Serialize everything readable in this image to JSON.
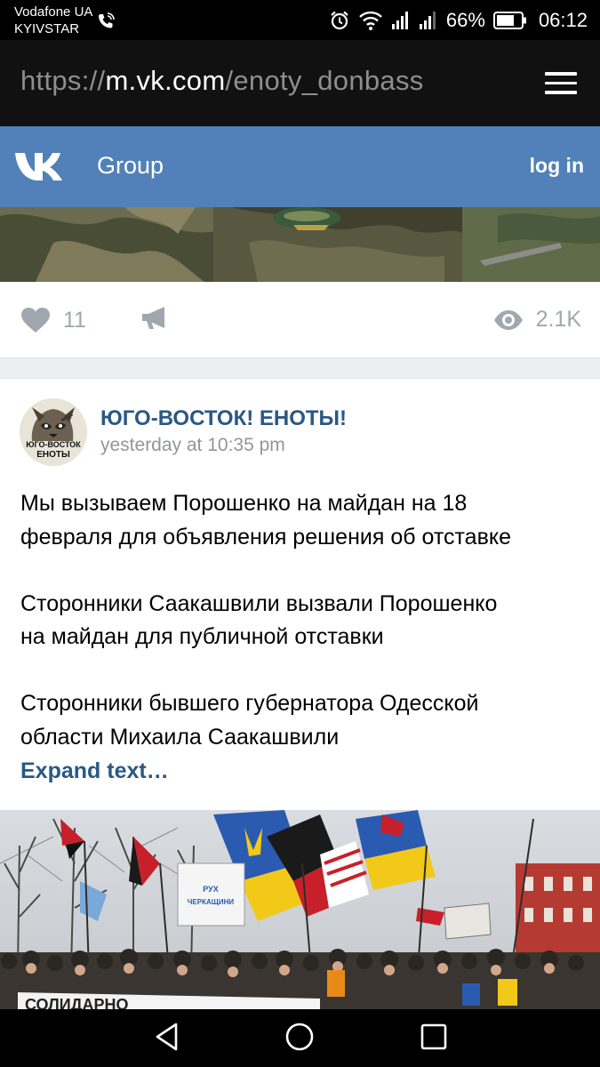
{
  "status_bar": {
    "carrier_line1": "Vodafone UA",
    "carrier_line2": "KYIVSTAR",
    "battery": "66%",
    "time": "06:12",
    "icons": [
      "wifi-call-icon",
      "alarm-icon",
      "wifi-icon",
      "signal-icon",
      "signal-icon",
      "battery-icon"
    ]
  },
  "browser": {
    "url_scheme": "https://",
    "url_host": "m.vk.com",
    "url_path": "/enoty_donbass",
    "menu_icon": "hamburger-menu-icon"
  },
  "vk_header": {
    "logo": "vk-logo",
    "title": "Group",
    "login": "log in",
    "color": "#5181b8"
  },
  "previous_post": {
    "likes": "11",
    "views": "2.1K",
    "icons": [
      "heart-icon",
      "megaphone-icon",
      "eye-icon"
    ]
  },
  "post": {
    "author": "ЮГО-ВОСТОК! ЕНОТЫ!",
    "avatar_text_line1": "ЮГО-ВОСТОК",
    "avatar_text_line2": "ЕНОТЫ",
    "time": "yesterday at 10:35 pm",
    "text_lines": [
      "Мы вызываем Порошенко на майдан на 18",
      "февраля для объявления решения об отставке",
      "",
      "Сторонники Саакашвили вызвали Порошенко",
      "на майдан для публичной отставки",
      "",
      "Сторонники бывшего губернатора Одесской",
      "области Михаила Саакашвили"
    ],
    "expand": "Expand text…",
    "photo_banner_text": "РУХ\nЧЕРКАЩИНИ",
    "photo_bottom_banner": "СОЛИДАРНО"
  },
  "nav_bar": {
    "icons": [
      "back-icon",
      "home-icon",
      "recent-apps-icon"
    ]
  }
}
